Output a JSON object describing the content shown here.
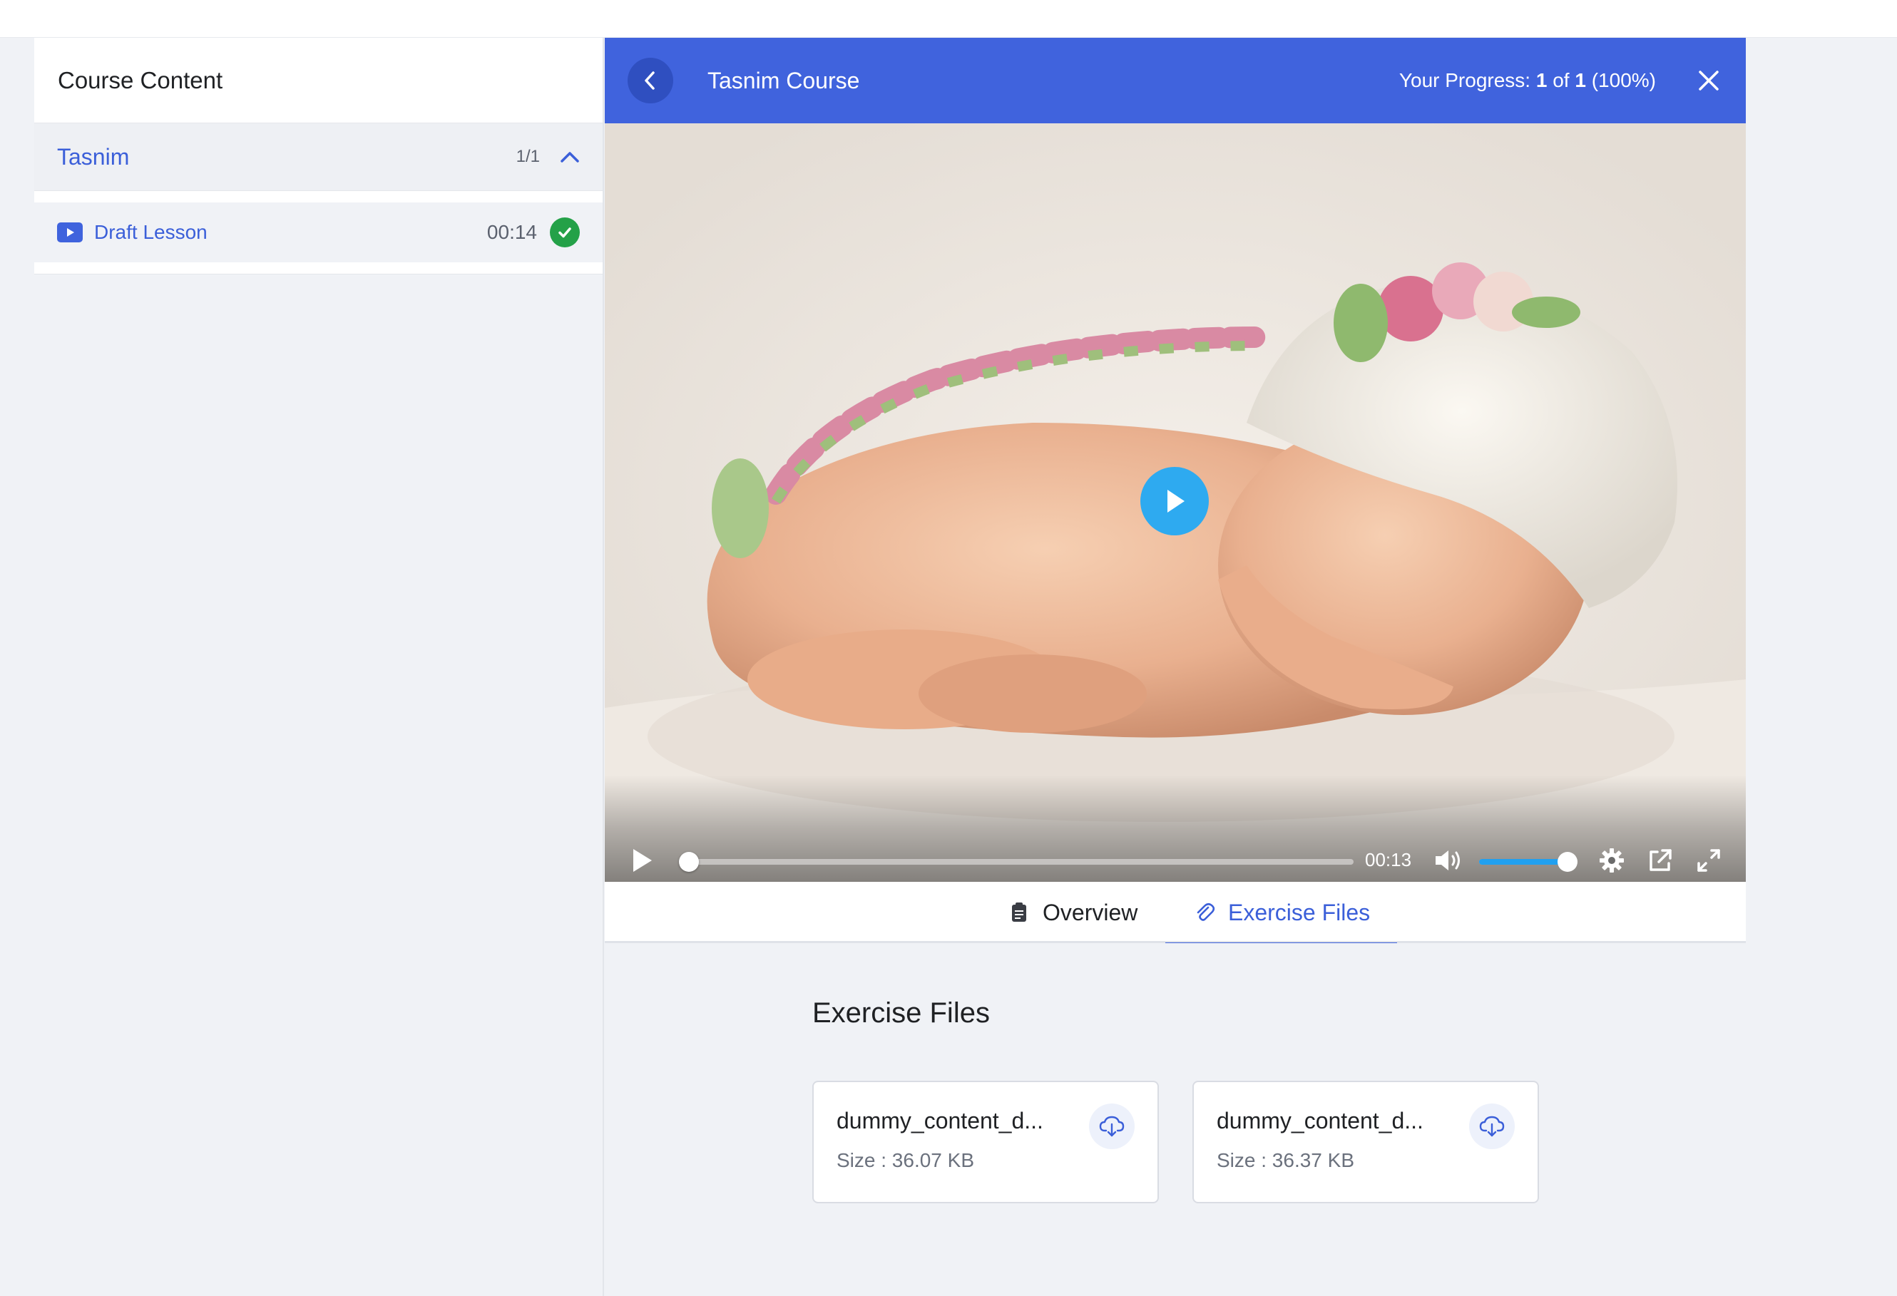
{
  "sidebar": {
    "header_title": "Course Content",
    "topic": {
      "title": "Tasnim",
      "count": "1/1"
    },
    "lessons": [
      {
        "title": "Draft Lesson",
        "duration": "00:14",
        "completed": true
      }
    ]
  },
  "header": {
    "course_title": "Tasnim Course",
    "progress_label": "Your Progress:",
    "progress_current": "1",
    "progress_of": "of",
    "progress_total": "1",
    "progress_percent": "(100%)"
  },
  "player": {
    "time": "00:13",
    "progress_fraction": 0.0,
    "volume_fraction": 1.0
  },
  "tabs": [
    {
      "label": "Overview",
      "active": false
    },
    {
      "label": "Exercise Files",
      "active": true
    }
  ],
  "exercise": {
    "heading": "Exercise Files",
    "files": [
      {
        "name": "dummy_content_d...",
        "size": "Size : 36.07 KB"
      },
      {
        "name": "dummy_content_d...",
        "size": "Size : 36.37 KB"
      }
    ]
  },
  "colors": {
    "accent": "#4063dd",
    "link": "#3b5fd9",
    "success": "#24a148",
    "player_play": "#2eaaf0",
    "volume": "#21a0ef"
  }
}
